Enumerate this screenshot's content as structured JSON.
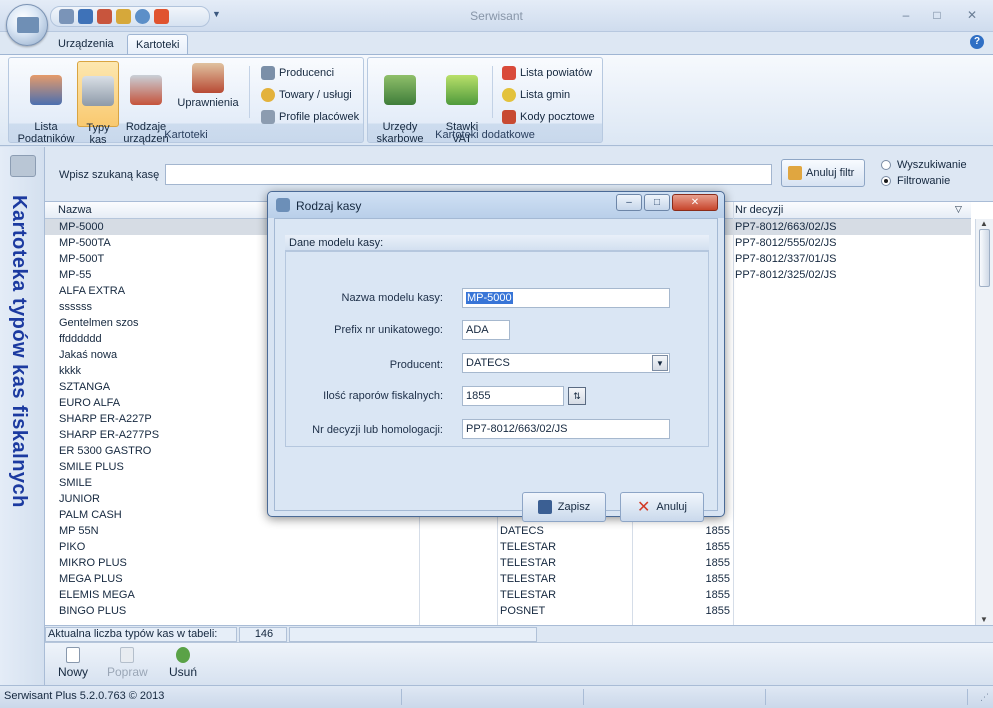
{
  "window": {
    "title": "Serwisant",
    "controls": {
      "minimize": "–",
      "maximize": "□",
      "close": "✕"
    }
  },
  "tabs": [
    {
      "label": "Urządzenia",
      "active": false
    },
    {
      "label": "Kartoteki",
      "active": true
    }
  ],
  "ribbon": {
    "group_kartoteki": {
      "label": "Kartoteki",
      "buttons": {
        "lista_podatnikow": "Lista\nPodatników",
        "typy_kas": "Typy\nkas",
        "rodzaje_urzadzen": "Rodzaje\nurządzeń",
        "uprawnienia": "Uprawnienia"
      },
      "small": {
        "producenci": "Producenci",
        "towary": "Towary / usługi",
        "profile": "Profile placówek"
      }
    },
    "group_dodatkowe": {
      "label": "Kartoteki dodatkowe",
      "buttons": {
        "urzedy": "Urzędy\nskarbowe",
        "stawki": "Stawki\nVAT"
      },
      "small": {
        "powiaty": "Lista powiatów",
        "gminy": "Lista gmin",
        "kody": "Kody pocztowe"
      }
    }
  },
  "side_title": "Kartoteka typów kas fiskalnych",
  "search": {
    "label": "Wpisz szukaną kasę",
    "value": "",
    "cancel_filter": "Anuluj filtr",
    "modes": [
      {
        "label": "Wyszukiwanie",
        "selected": false
      },
      {
        "label": "Filtrowanie",
        "selected": true
      }
    ]
  },
  "grid": {
    "headers": {
      "nazwa": "Nazwa",
      "nr_decyzji": "Nr decyzji"
    },
    "rows": [
      {
        "nazwa": "MP-5000",
        "producent": "",
        "ilosc": "",
        "decyzja": "PP7-8012/663/02/JS",
        "selected": true
      },
      {
        "nazwa": "MP-500TA",
        "producent": "",
        "ilosc": "",
        "decyzja": "PP7-8012/555/02/JS"
      },
      {
        "nazwa": "MP-500T",
        "producent": "",
        "ilosc": "",
        "decyzja": "PP7-8012/337/01/JS"
      },
      {
        "nazwa": "MP-55",
        "producent": "",
        "ilosc": "",
        "decyzja": "PP7-8012/325/02/JS"
      },
      {
        "nazwa": "ALFA EXTRA",
        "producent": "",
        "ilosc": "",
        "decyzja": ""
      },
      {
        "nazwa": "ssssss",
        "producent": "",
        "ilosc": "",
        "decyzja": ""
      },
      {
        "nazwa": "Gentelmen szos",
        "producent": "",
        "ilosc": "",
        "decyzja": ""
      },
      {
        "nazwa": "ffdddddd",
        "producent": "",
        "ilosc": "",
        "decyzja": ""
      },
      {
        "nazwa": "Jakaś nowa",
        "producent": "",
        "ilosc": "",
        "decyzja": ""
      },
      {
        "nazwa": "kkkk",
        "producent": "",
        "ilosc": "",
        "decyzja": ""
      },
      {
        "nazwa": "SZTANGA",
        "producent": "",
        "ilosc": "",
        "decyzja": ""
      },
      {
        "nazwa": "EURO ALFA",
        "producent": "",
        "ilosc": "",
        "decyzja": ""
      },
      {
        "nazwa": "SHARP ER-A227P",
        "producent": "",
        "ilosc": "",
        "decyzja": ""
      },
      {
        "nazwa": "SHARP ER-A277PS",
        "producent": "",
        "ilosc": "",
        "decyzja": ""
      },
      {
        "nazwa": "ER 5300 GASTRO",
        "producent": "",
        "ilosc": "",
        "decyzja": ""
      },
      {
        "nazwa": "SMILE PLUS",
        "producent": "",
        "ilosc": "",
        "decyzja": ""
      },
      {
        "nazwa": "SMILE",
        "producent": "",
        "ilosc": "",
        "decyzja": ""
      },
      {
        "nazwa": "JUNIOR",
        "producent": "",
        "ilosc": "",
        "decyzja": ""
      },
      {
        "nazwa": "PALM CASH",
        "producent": "",
        "ilosc": "",
        "decyzja": ""
      },
      {
        "nazwa": "MP 55N",
        "producent": "DATECS",
        "ilosc": "1855",
        "decyzja": ""
      },
      {
        "nazwa": "PIKO",
        "producent": "TELESTAR",
        "ilosc": "1855",
        "decyzja": ""
      },
      {
        "nazwa": "MIKRO PLUS",
        "producent": "TELESTAR",
        "ilosc": "1855",
        "decyzja": ""
      },
      {
        "nazwa": "MEGA PLUS",
        "producent": "TELESTAR",
        "ilosc": "1855",
        "decyzja": ""
      },
      {
        "nazwa": "ELEMIS MEGA",
        "producent": "TELESTAR",
        "ilosc": "1855",
        "decyzja": ""
      },
      {
        "nazwa": "BINGO PLUS",
        "producent": "POSNET",
        "ilosc": "1855",
        "decyzja": ""
      }
    ]
  },
  "table_status": {
    "label": "Aktualna liczba typów kas w tabeli:",
    "count": "146"
  },
  "bottom_toolbar": {
    "nowy": "Nowy",
    "popraw": "Popraw",
    "usun": "Usuń"
  },
  "statusbar": {
    "version": "Serwisant Plus 5.2.0.763 © 2013"
  },
  "dialog": {
    "title": "Rodzaj kasy",
    "section": "Dane modelu kasy:",
    "fields": {
      "nazwa_label": "Nazwa modelu kasy:",
      "nazwa_value": "MP-5000",
      "prefix_label": "Prefix nr unikatowego:",
      "prefix_value": "ADA",
      "producent_label": "Producent:",
      "producent_value": "DATECS",
      "ilosc_label": "Ilość raporów fiskalnych:",
      "ilosc_value": "1855",
      "decyzja_label": "Nr decyzji lub homologacji:",
      "decyzja_value": "PP7-8012/663/02/JS"
    },
    "buttons": {
      "zapisz": "Zapisz",
      "anuluj": "Anuluj"
    }
  }
}
